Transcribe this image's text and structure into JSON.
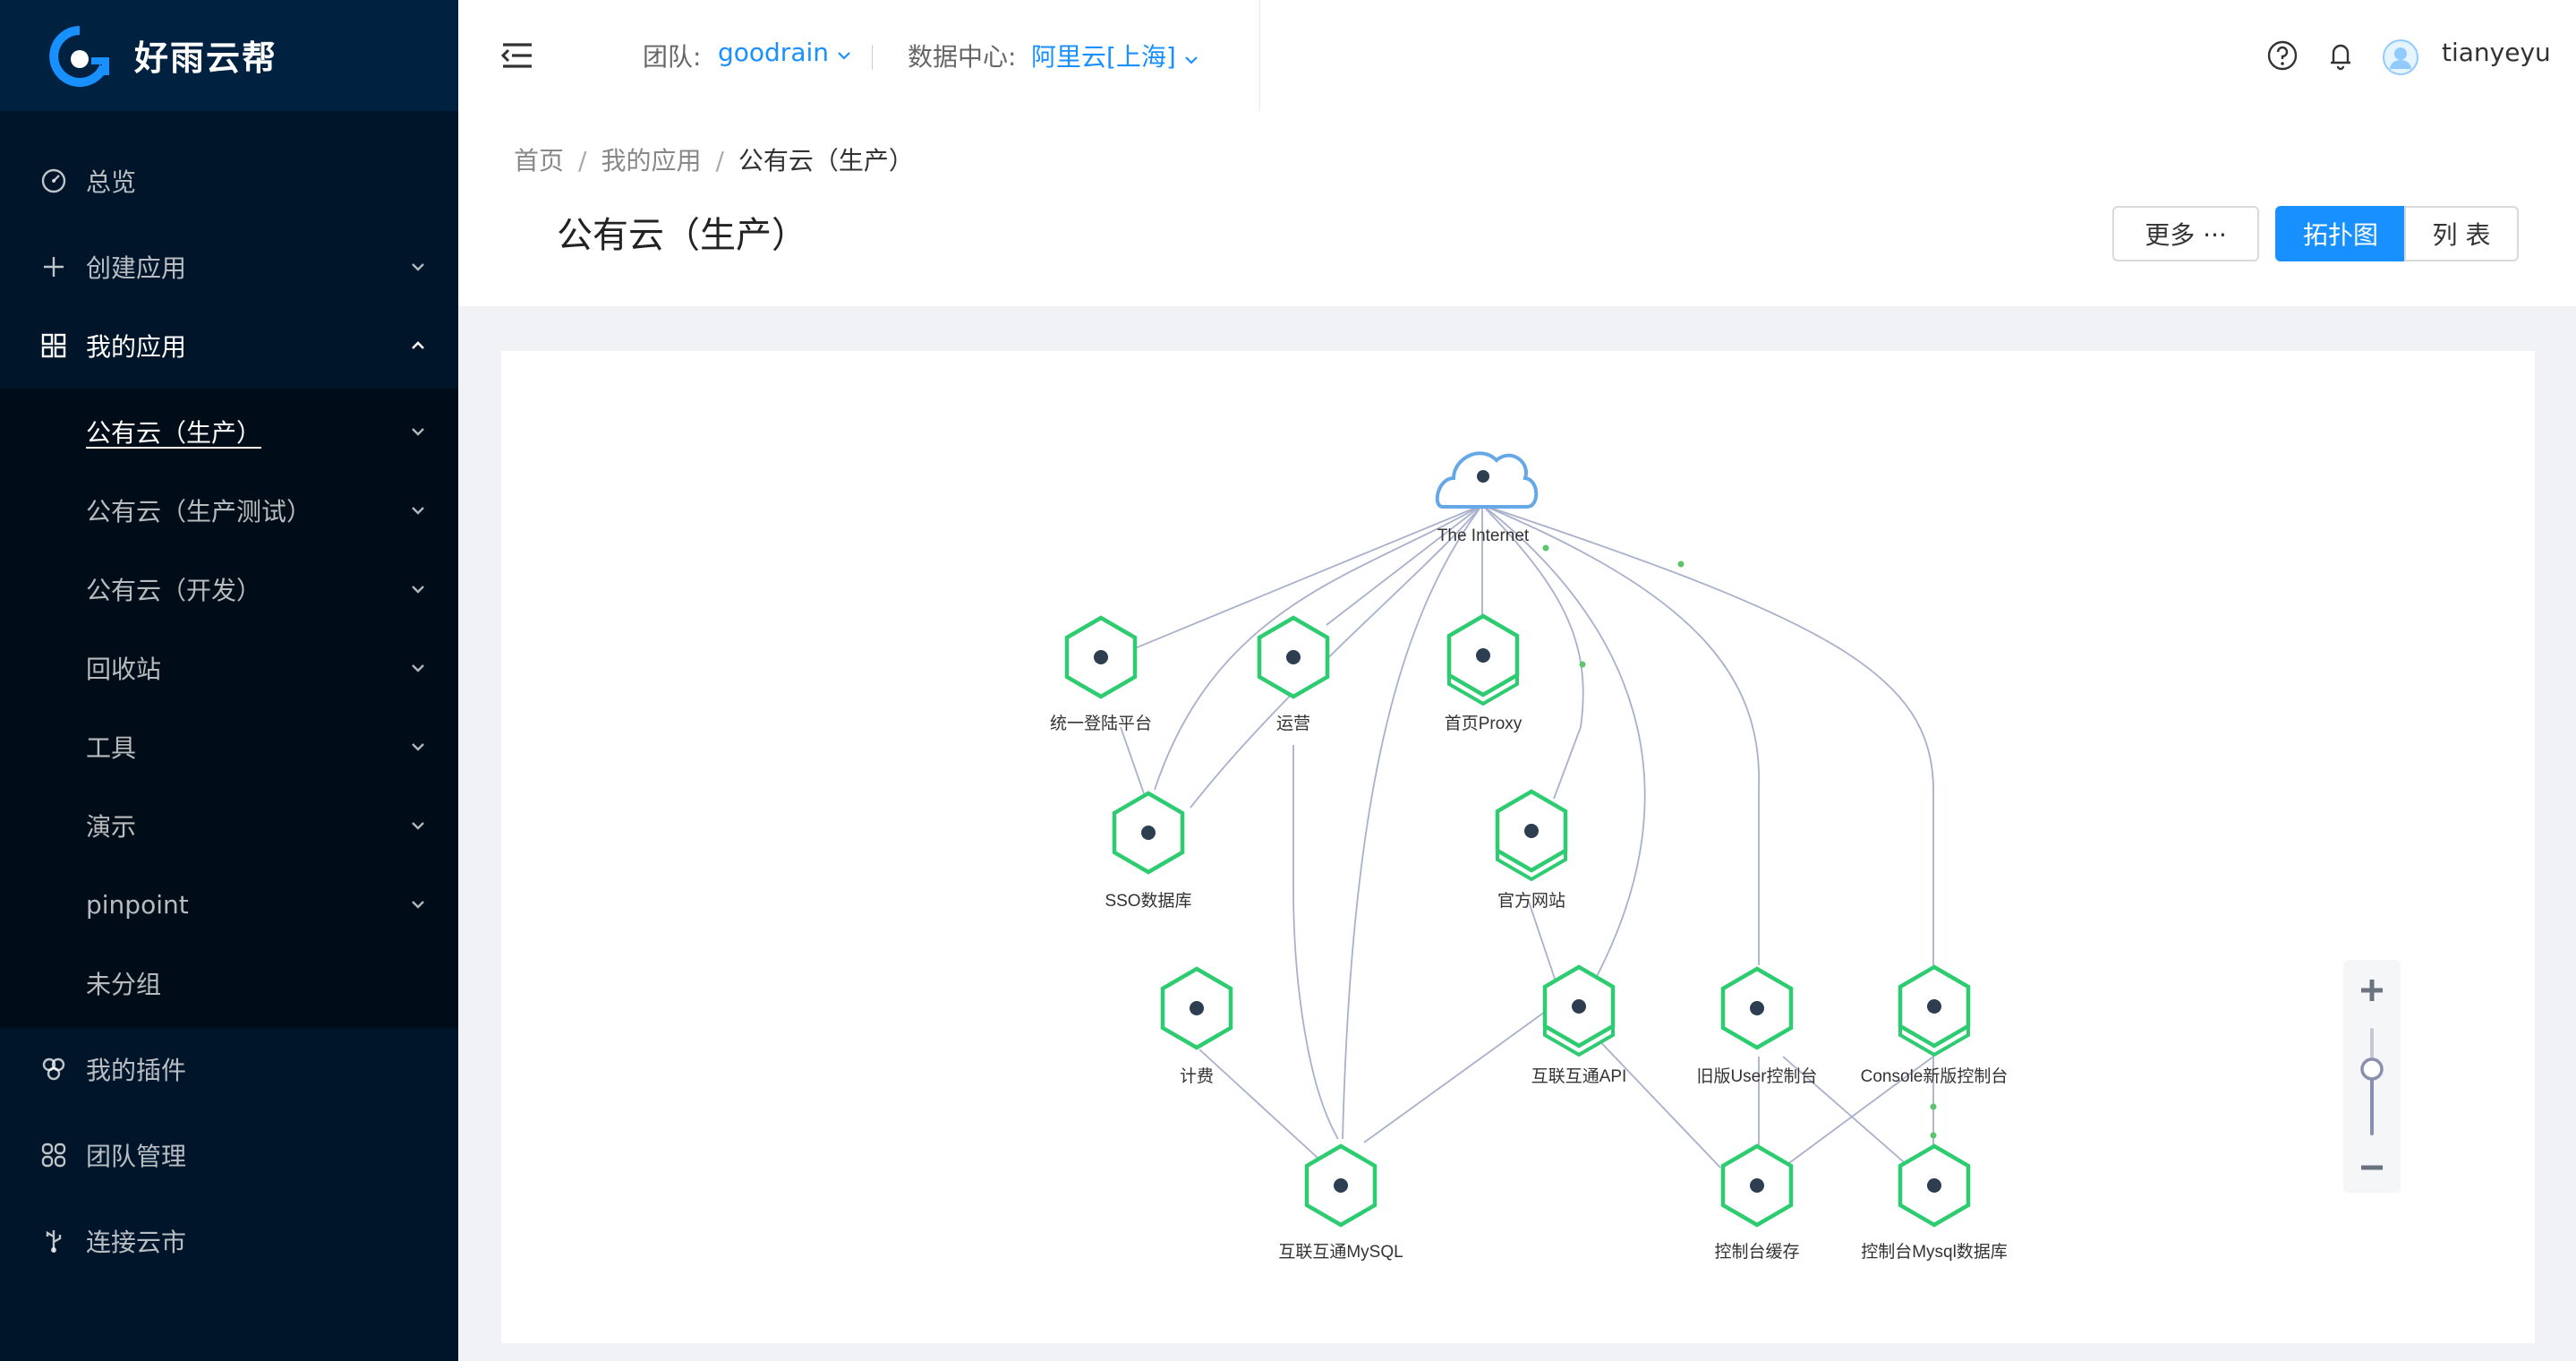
{
  "brand": {
    "name": "好雨云帮"
  },
  "sidebar": {
    "items": [
      {
        "label": "总览",
        "icon": "dashboard-icon"
      },
      {
        "label": "创建应用",
        "icon": "plus-icon"
      },
      {
        "label": "我的应用",
        "icon": "appstore-icon"
      }
    ],
    "groups": [
      {
        "label": "公有云（生产）"
      },
      {
        "label": "公有云（生产测试）"
      },
      {
        "label": "公有云（开发）"
      },
      {
        "label": "回收站"
      },
      {
        "label": "工具"
      },
      {
        "label": "演示"
      },
      {
        "label": "pinpoint"
      },
      {
        "label": "未分组"
      }
    ],
    "bottom": [
      {
        "label": "我的插件",
        "icon": "plugin-icon"
      },
      {
        "label": "团队管理",
        "icon": "team-icon"
      },
      {
        "label": "连接云市",
        "icon": "usb-icon"
      }
    ]
  },
  "header": {
    "team_label": "团队:",
    "team_value": "goodrain",
    "dc_label": "数据中心:",
    "dc_value": "阿里云[上海]",
    "username": "tianyeyu"
  },
  "breadcrumb": {
    "home": "首页",
    "apps": "我的应用",
    "current": "公有云（生产）"
  },
  "page": {
    "title": "公有云（生产）",
    "more_label": "更多 ···",
    "topo_label": "拓扑图",
    "list_label": "列 表"
  },
  "topology": {
    "internet_label": "The Internet",
    "nodes": [
      {
        "id": "sso-platform",
        "label": "统一登陆平台",
        "stacked": false
      },
      {
        "id": "ops",
        "label": "运营",
        "stacked": false
      },
      {
        "id": "home-proxy",
        "label": "首页Proxy",
        "stacked": true
      },
      {
        "id": "sso-db",
        "label": "SSO数据库",
        "stacked": false
      },
      {
        "id": "official-site",
        "label": "官方网站",
        "stacked": true
      },
      {
        "id": "billing",
        "label": "计费",
        "stacked": false
      },
      {
        "id": "api",
        "label": "互联互通API",
        "stacked": true
      },
      {
        "id": "old-console",
        "label": "旧版User控制台",
        "stacked": false
      },
      {
        "id": "new-console",
        "label": "Console新版控制台",
        "stacked": true
      },
      {
        "id": "mysql",
        "label": "互联互通MySQL",
        "stacked": false
      },
      {
        "id": "console-cache",
        "label": "控制台缓存",
        "stacked": false
      },
      {
        "id": "console-mysql",
        "label": "控制台Mysql数据库",
        "stacked": false
      }
    ]
  },
  "zoom": {
    "plus": "+",
    "minus": "−"
  },
  "colors": {
    "primary": "#1890ff",
    "sidebar": "#001529",
    "node": "#2ecc71"
  }
}
